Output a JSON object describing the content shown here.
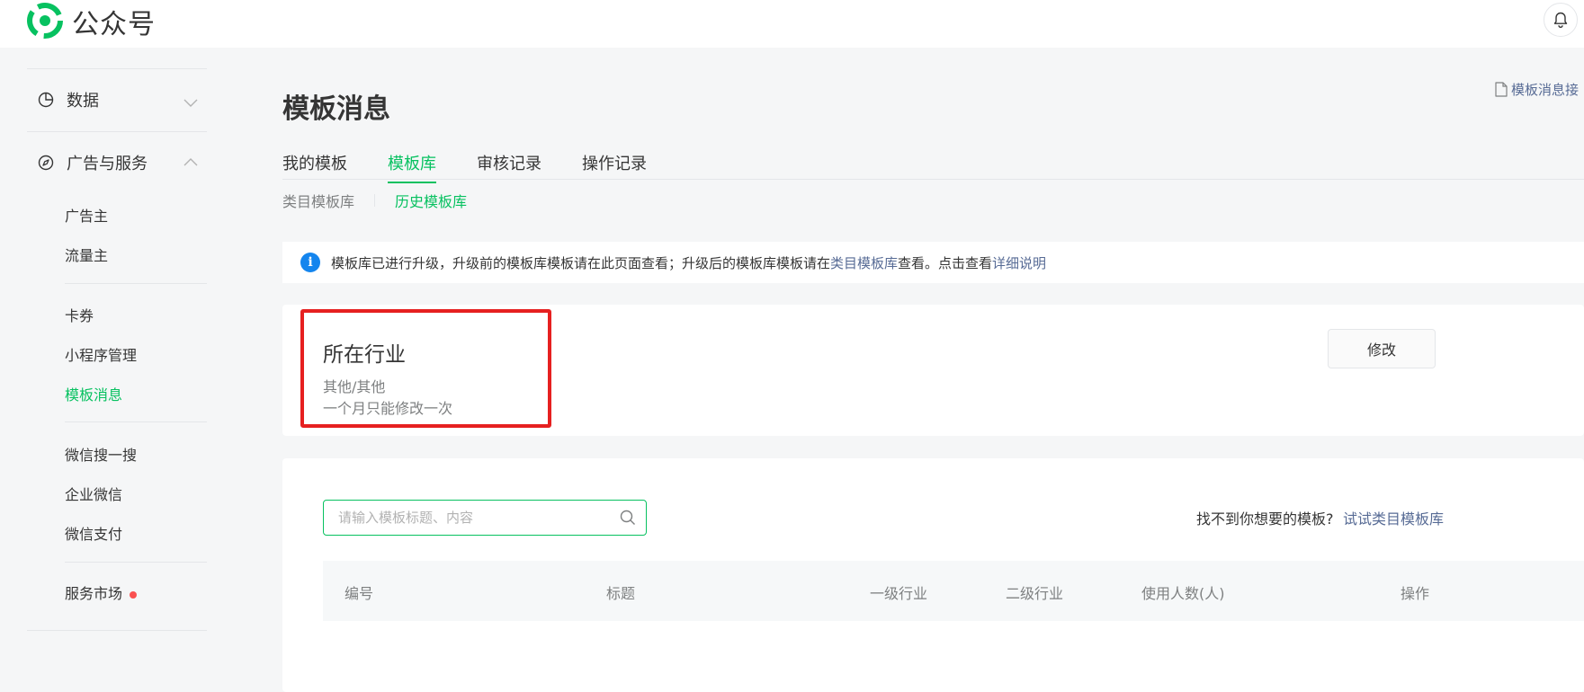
{
  "header": {
    "logo_text": "公众号",
    "logo_color": "#07c160"
  },
  "sidebar": {
    "groups": [
      {
        "label": "数据",
        "icon": "pie-chart-icon",
        "expanded": false
      },
      {
        "label": "广告与服务",
        "icon": "compass-icon",
        "expanded": true
      }
    ],
    "items": [
      {
        "label": "广告主"
      },
      {
        "label": "流量主"
      },
      {
        "label": "卡券"
      },
      {
        "label": "小程序管理"
      },
      {
        "label": "模板消息",
        "active": true
      },
      {
        "label": "微信搜一搜"
      },
      {
        "label": "企业微信"
      },
      {
        "label": "微信支付"
      },
      {
        "label": "服务市场",
        "badge": "red-dot"
      }
    ]
  },
  "main": {
    "title": "模板消息",
    "doc_link": "模板消息接",
    "tabs": [
      {
        "label": "我的模板"
      },
      {
        "label": "模板库",
        "active": true
      },
      {
        "label": "审核记录"
      },
      {
        "label": "操作记录"
      }
    ],
    "subtabs": [
      {
        "label": "类目模板库"
      },
      {
        "label": "历史模板库",
        "active": true
      }
    ],
    "notice": {
      "text_before": "模板库已进行升级，升级前的模板库模板请在此页面查看；升级后的模板库模板请在",
      "link1": "类目模板库",
      "text_middle": "查看。点击查看",
      "link2": "详细说明"
    },
    "industry": {
      "title": "所在行业",
      "value": "其他/其他",
      "note": "一个月只能修改一次",
      "modify_label": "修改"
    },
    "library": {
      "search_placeholder": "请输入模板标题、内容",
      "not_found_text": "找不到你想要的模板?",
      "not_found_link": "试试类目模板库",
      "columns": [
        "编号",
        "标题",
        "一级行业",
        "二级行业",
        "使用人数(人)",
        "操作"
      ]
    }
  },
  "colors": {
    "accent": "#07c160",
    "link": "#576b95",
    "highlight": "#e62020",
    "info": "#1485ee"
  }
}
